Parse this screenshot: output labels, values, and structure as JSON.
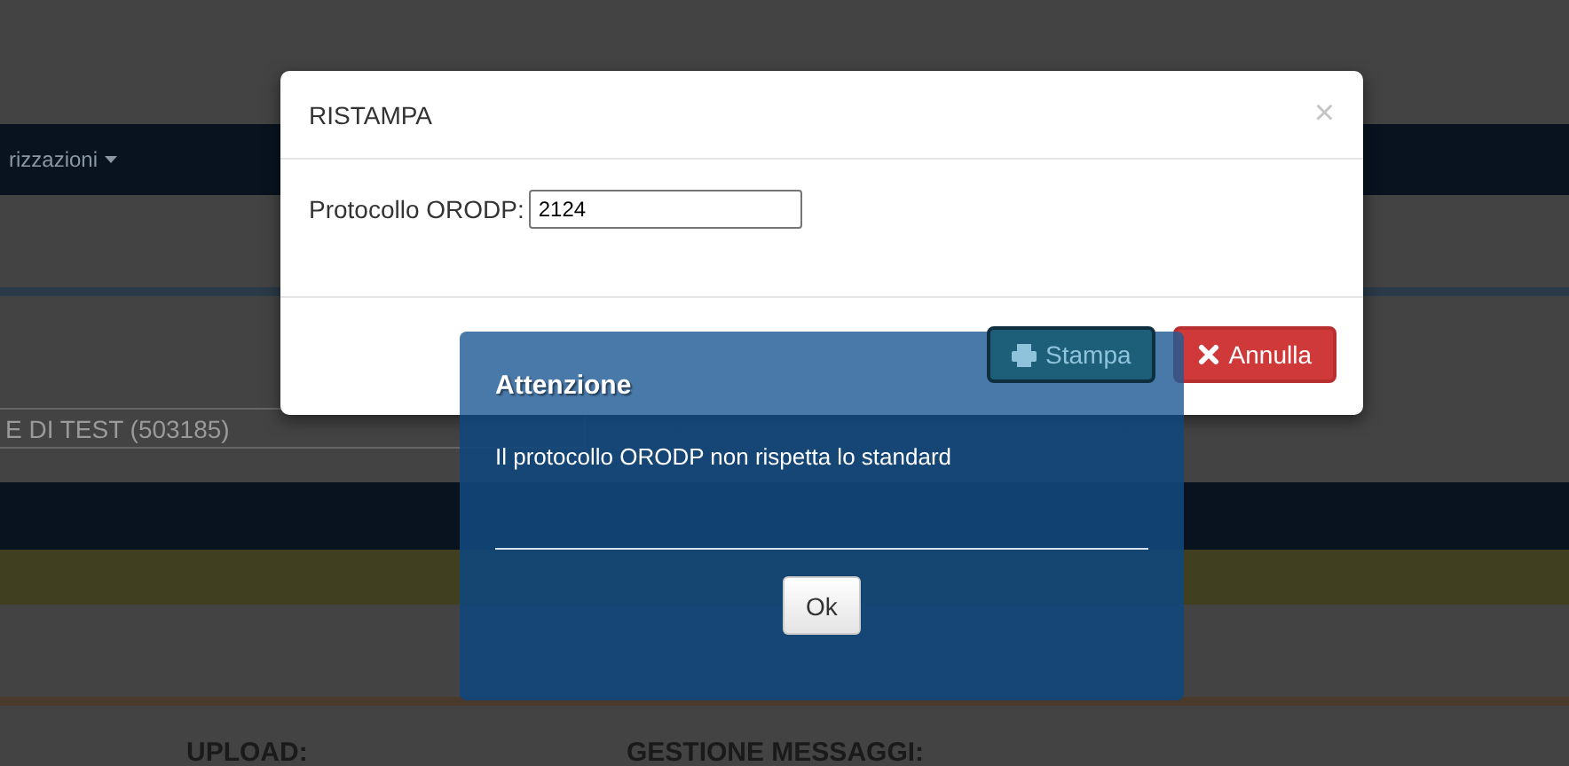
{
  "page": {
    "nav_menu": "rizzazioni",
    "select_value": "E DI TEST (503185)",
    "sections": [
      "UPLOAD:",
      "GESTIONE MESSAGGI:"
    ]
  },
  "dialog": {
    "title": "RISTAMPA",
    "close": "×",
    "field_label": "Protocollo ORODP:",
    "field_value": "2124",
    "buttons": [
      {
        "label": "Stampa",
        "kind": "primary"
      },
      {
        "label": "Annulla",
        "kind": "danger"
      }
    ]
  },
  "alert": {
    "title": "Attenzione",
    "message": "Il protocollo ORODP non rispetta lo standard",
    "button": "Ok"
  }
}
